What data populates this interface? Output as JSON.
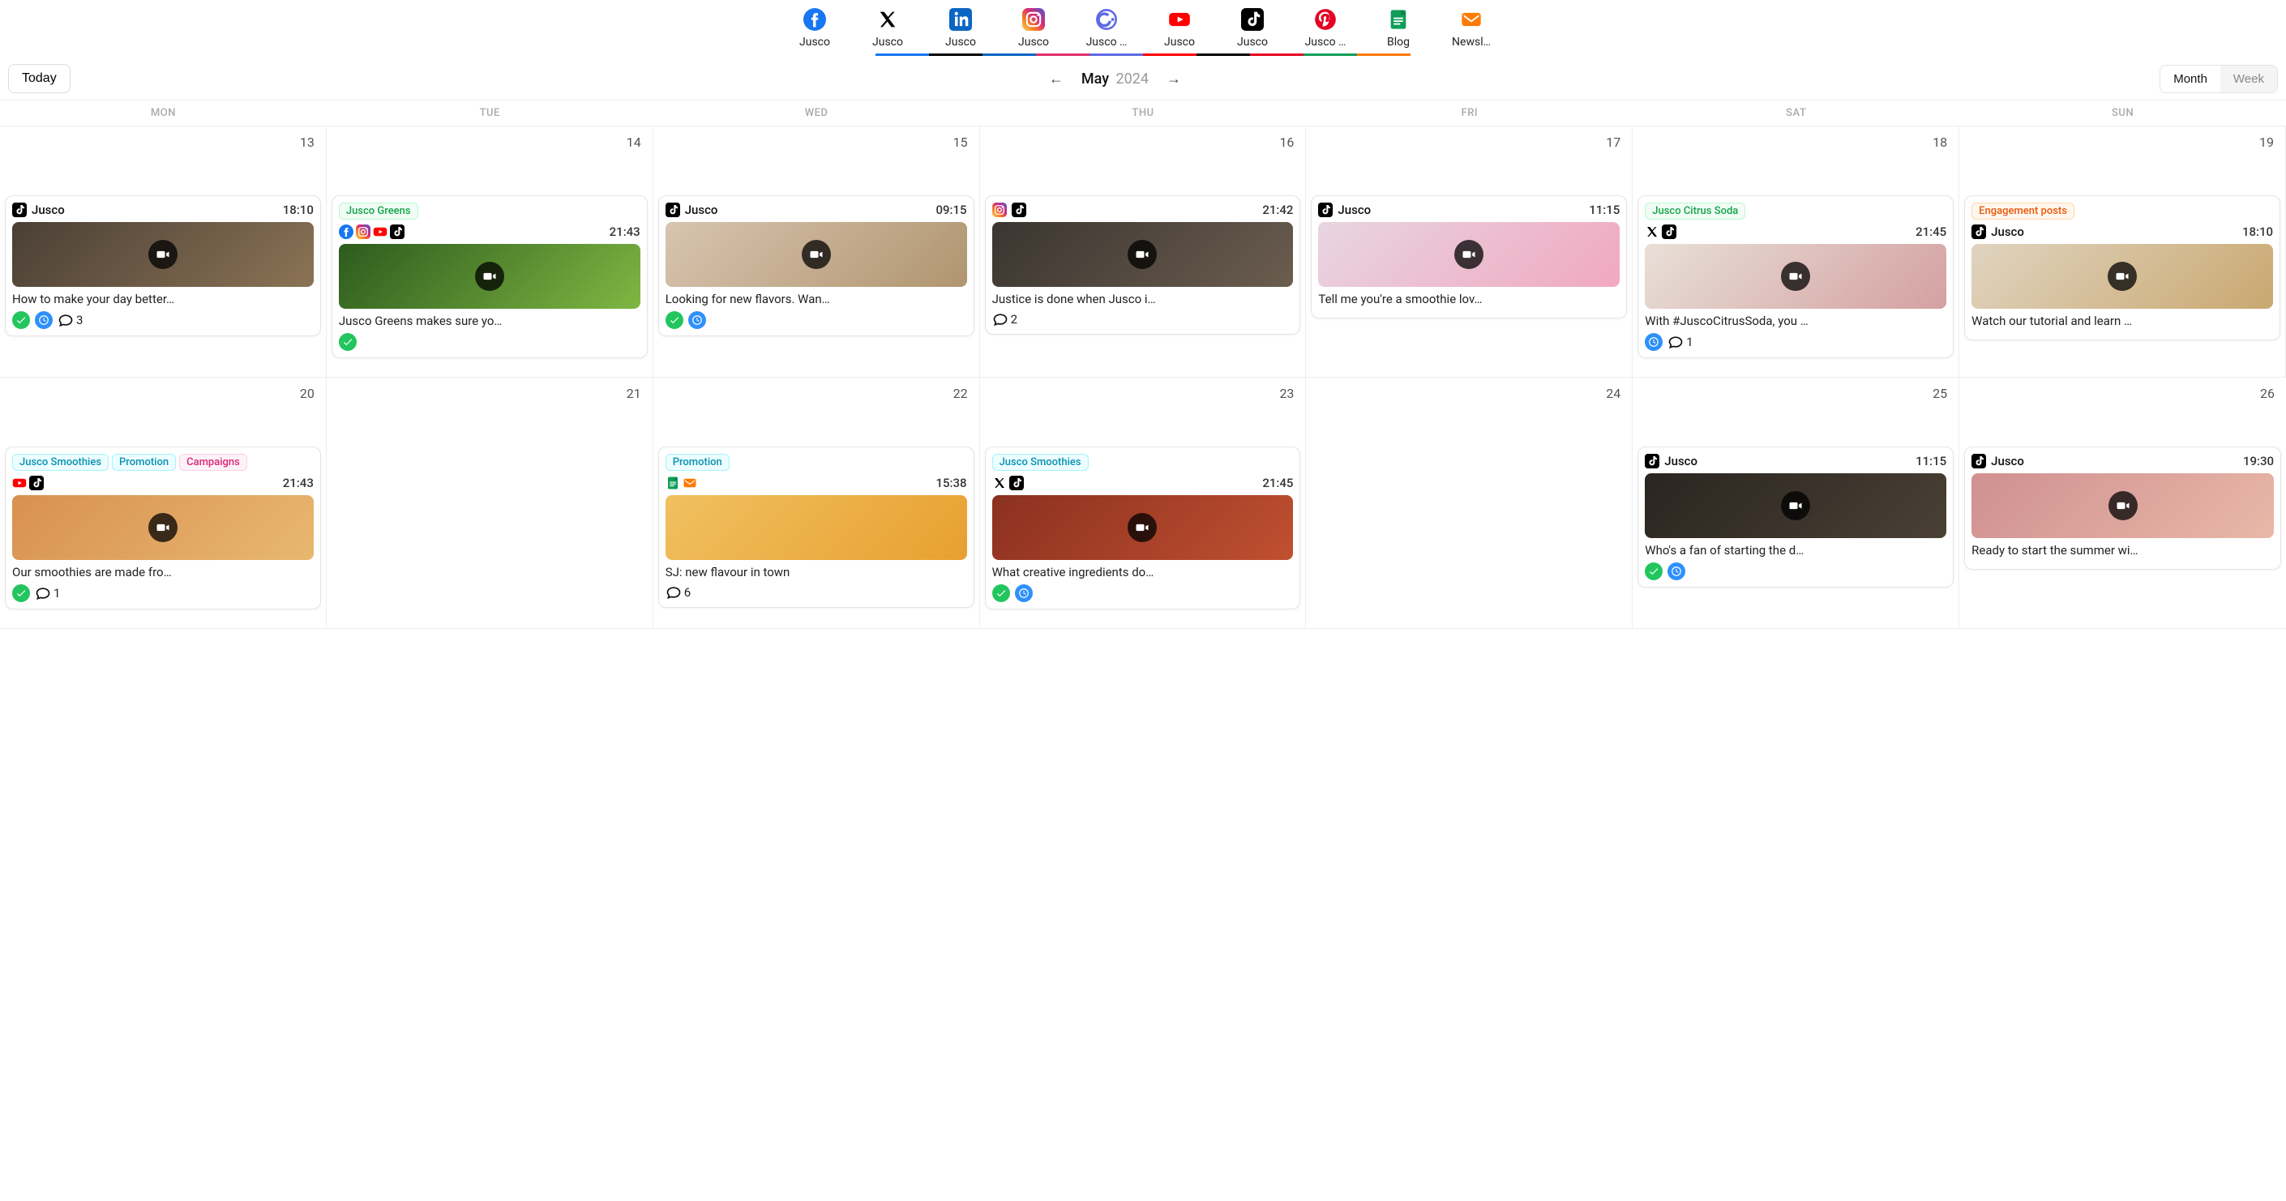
{
  "channels": [
    {
      "id": "facebook",
      "label": "Jusco",
      "color": "#1877F2"
    },
    {
      "id": "x",
      "label": "Jusco",
      "color": "#000000"
    },
    {
      "id": "linkedin",
      "label": "Jusco",
      "color": "#0A66C2"
    },
    {
      "id": "instagram",
      "label": "Jusco",
      "color": "#E1306C"
    },
    {
      "id": "google",
      "label": "Jusco …",
      "color": "#5F6AE6"
    },
    {
      "id": "youtube",
      "label": "Jusco",
      "color": "#FF0000"
    },
    {
      "id": "tiktok",
      "label": "Jusco",
      "color": "#000000"
    },
    {
      "id": "pinterest",
      "label": "Jusco …",
      "color": "#E60023"
    },
    {
      "id": "docs",
      "label": "Blog",
      "color": "#0F9D58"
    },
    {
      "id": "mail",
      "label": "Newsl…",
      "color": "#FF7A00"
    }
  ],
  "toolbar": {
    "today_label": "Today",
    "month": "May",
    "year": "2024",
    "view": {
      "month": "Month",
      "week": "Week",
      "active": "month"
    }
  },
  "weekdays": [
    "MON",
    "TUE",
    "WED",
    "THU",
    "FRI",
    "SAT",
    "SUN"
  ],
  "rows": [
    {
      "dates": [
        "13",
        "14",
        "15",
        "16",
        "17",
        "18",
        "19"
      ],
      "posts": [
        {
          "day": 0,
          "tags": [],
          "platforms": [
            "tiktok"
          ],
          "account": "Jusco",
          "time": "18:10",
          "thumb": {
            "video": true,
            "bg": "linear-gradient(135deg,#4a3f35,#8b7355)"
          },
          "caption": "How to make your day better…",
          "status": {
            "ok": true,
            "clock": true,
            "comments": 3
          }
        },
        {
          "day": 1,
          "tags": [
            {
              "text": "Jusco Greens",
              "cls": "green"
            }
          ],
          "platforms_row2": [
            "facebook",
            "instagram",
            "youtube",
            "tiktok"
          ],
          "time": "21:43",
          "thumb": {
            "video": true,
            "bg": "linear-gradient(135deg,#2d5a1e,#7fb742)"
          },
          "caption": "Jusco Greens makes sure yo…",
          "status": {
            "ok": true
          }
        },
        {
          "day": 2,
          "tags": [],
          "platforms": [
            "tiktok"
          ],
          "account": "Jusco",
          "time": "09:15",
          "thumb": {
            "video": true,
            "bg": "linear-gradient(135deg,#d8c4b0,#b0956f)"
          },
          "caption": "Looking for new flavors. Wan…",
          "status": {
            "ok": true,
            "clock": true
          }
        },
        {
          "day": 3,
          "tags": [],
          "platforms": [
            "instagram",
            "tiktok"
          ],
          "time": "21:42",
          "thumb": {
            "video": true,
            "bg": "linear-gradient(135deg,#3a3530,#6b5d4f)"
          },
          "caption": "Justice is done when Jusco i…",
          "status": {
            "comments": 2
          }
        },
        {
          "day": 4,
          "tags": [],
          "platforms": [
            "tiktok"
          ],
          "account": "Jusco",
          "time": "11:15",
          "thumb": {
            "video": true,
            "bg": "linear-gradient(135deg,#e8d5e0,#f0a8c0)"
          },
          "caption": "Tell me you're a smoothie lov…",
          "status": {}
        },
        {
          "day": 5,
          "tags": [
            {
              "text": "Jusco Citrus Soda",
              "cls": "green"
            }
          ],
          "platforms_row2": [
            "x",
            "tiktok"
          ],
          "time": "21:45",
          "thumb": {
            "video": true,
            "bg": "linear-gradient(135deg,#e8e0d8,#d4a0a0)"
          },
          "caption": "With #JuscoCitrusSoda, you …",
          "status": {
            "clock": true,
            "comments": 1
          }
        },
        {
          "day": 6,
          "tags": [
            {
              "text": "Engagement posts",
              "cls": "orange"
            }
          ],
          "platforms_row2_account": {
            "platforms": [
              "tiktok"
            ],
            "name": "Jusco"
          },
          "time": "18:10",
          "thumb": {
            "video": true,
            "bg": "linear-gradient(135deg,#e0d4c0,#c9a870)"
          },
          "caption": "Watch our tutorial and learn …",
          "status": {}
        }
      ]
    },
    {
      "dates": [
        "20",
        "21",
        "22",
        "23",
        "24",
        "25",
        "26"
      ],
      "posts": [
        {
          "day": 0,
          "tags": [
            {
              "text": "Jusco Smoothies",
              "cls": "cyan"
            },
            {
              "text": "Promotion",
              "cls": "cyan"
            },
            {
              "text": "Campaigns",
              "cls": "pink"
            }
          ],
          "platforms_row2": [
            "youtube",
            "tiktok"
          ],
          "time": "21:43",
          "thumb": {
            "video": true,
            "bg": "linear-gradient(135deg,#d89050,#e8b870)"
          },
          "caption": "Our smoothies are made fro…",
          "status": {
            "ok": true,
            "comments": 1
          }
        },
        {
          "day": 2,
          "tags": [
            {
              "text": "Promotion",
              "cls": "cyan"
            }
          ],
          "platforms_row2": [
            "docs",
            "mail"
          ],
          "time": "15:38",
          "thumb": {
            "video": false,
            "bg": "linear-gradient(135deg,#f0c060,#e8a030)"
          },
          "caption": "SJ: new flavour in town",
          "status": {
            "comments": 6
          }
        },
        {
          "day": 3,
          "tags": [
            {
              "text": "Jusco Smoothies",
              "cls": "cyan"
            }
          ],
          "platforms_row2": [
            "x",
            "tiktok"
          ],
          "time": "21:45",
          "thumb": {
            "video": true,
            "bg": "linear-gradient(135deg,#8b3020,#c05030)"
          },
          "caption": "What creative ingredients do…",
          "status": {
            "ok": true,
            "clock": true
          }
        },
        {
          "day": 5,
          "tags": [],
          "platforms": [
            "tiktok"
          ],
          "account": "Jusco",
          "time": "11:15",
          "thumb": {
            "video": true,
            "bg": "linear-gradient(135deg,#2a2520,#4a4035)"
          },
          "caption": "Who's a fan of starting the d…",
          "status": {
            "ok": true,
            "clock": true
          }
        },
        {
          "day": 6,
          "tags": [],
          "platforms": [
            "tiktok"
          ],
          "account": "Jusco",
          "time": "19:30",
          "thumb": {
            "video": true,
            "bg": "linear-gradient(135deg,#d09090,#e8b8a8)"
          },
          "caption": "Ready to start the summer wi…",
          "status": {}
        }
      ]
    }
  ]
}
